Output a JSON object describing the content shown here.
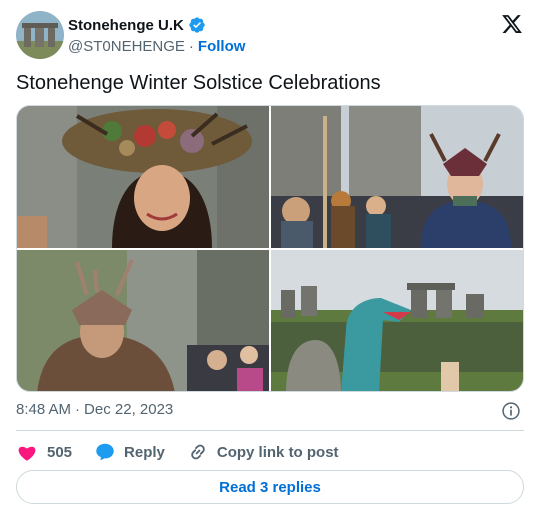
{
  "author": {
    "display_name": "Stonehenge U.K",
    "handle": "@ST0NEHENGE",
    "separator": "·",
    "follow_label": "Follow",
    "verified_icon": "verified-badge-icon",
    "brand_color": "#1d9bf0"
  },
  "tweet": {
    "text": "Stonehenge Winter Solstice Celebrations"
  },
  "media": {
    "photos": [
      "solstice-headdress-woman",
      "antlered-man-crowd",
      "fur-costume-man",
      "stones-crowd-dinosaur"
    ]
  },
  "meta": {
    "time": "8:48 AM",
    "separator": "·",
    "date": "Dec 22, 2023"
  },
  "actions": {
    "like_count": "505",
    "like_color": "#f91880",
    "reply_label": "Reply",
    "reply_color": "#1d9bf0",
    "copy_label": "Copy link to post"
  },
  "footer": {
    "read_replies_label": "Read 3 replies"
  },
  "colors": {
    "text_primary": "#0f1419",
    "text_secondary": "#536471",
    "link": "#006fd6",
    "border": "#cfd9de"
  }
}
